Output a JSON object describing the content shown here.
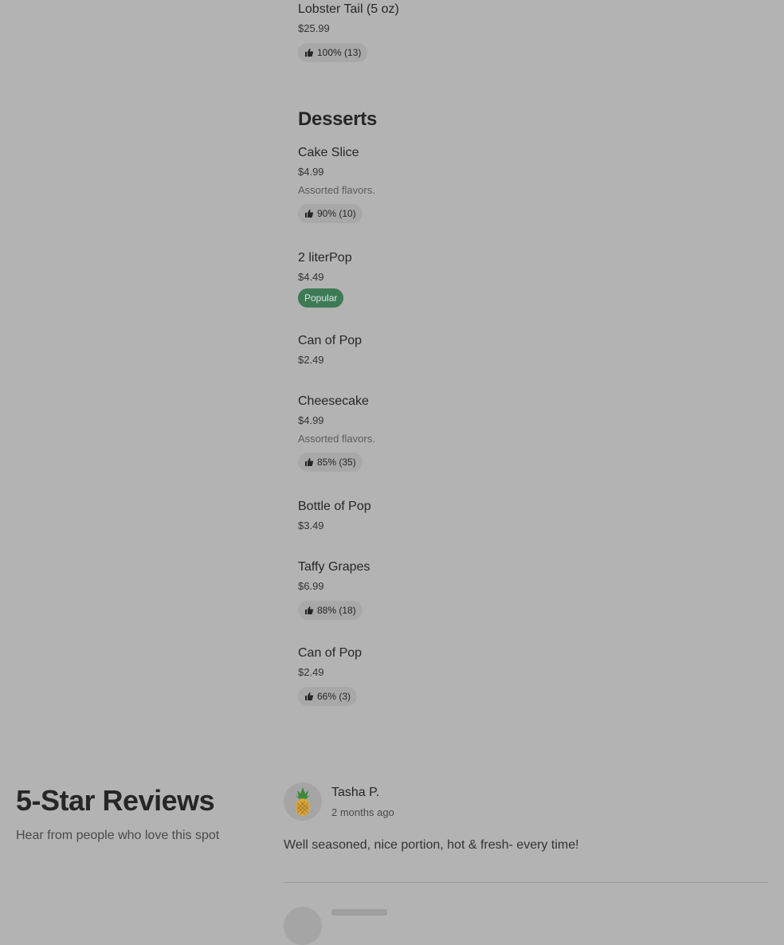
{
  "top_item": {
    "name": "Lobster Tail (5 oz)",
    "price": "$25.99",
    "rating": "100% (13)"
  },
  "section": {
    "title": "Desserts"
  },
  "items": [
    {
      "name": "Cake Slice",
      "price": "$4.99",
      "desc": "Assorted flavors.",
      "rating": "90% (10)"
    },
    {
      "name": "2 literPop",
      "price": "$4.49",
      "badge": "Popular"
    },
    {
      "name": "Can of Pop",
      "price": "$2.49"
    },
    {
      "name": "Cheesecake",
      "price": "$4.99",
      "desc": "Assorted flavors.",
      "rating": "85% (35)"
    },
    {
      "name": "Bottle of Pop",
      "price": "$3.49"
    },
    {
      "name": "Taffy Grapes",
      "price": "$6.99",
      "rating": "88% (18)"
    },
    {
      "name": "Can of Pop",
      "price": "$2.49",
      "rating": "66% (3)"
    }
  ],
  "reviews": {
    "heading": "5-Star Reviews",
    "subheading": "Hear from people who love this spot",
    "list": [
      {
        "name": "Tasha P.",
        "time": "2 months ago",
        "text": "Well seasoned, nice portion, hot & fresh- every time!",
        "avatar_icon": "pineapple-icon"
      }
    ]
  },
  "colors": {
    "background": "#b3b3b3",
    "popular_badge": "#3d7a56",
    "pill": "#a8a8a8"
  }
}
